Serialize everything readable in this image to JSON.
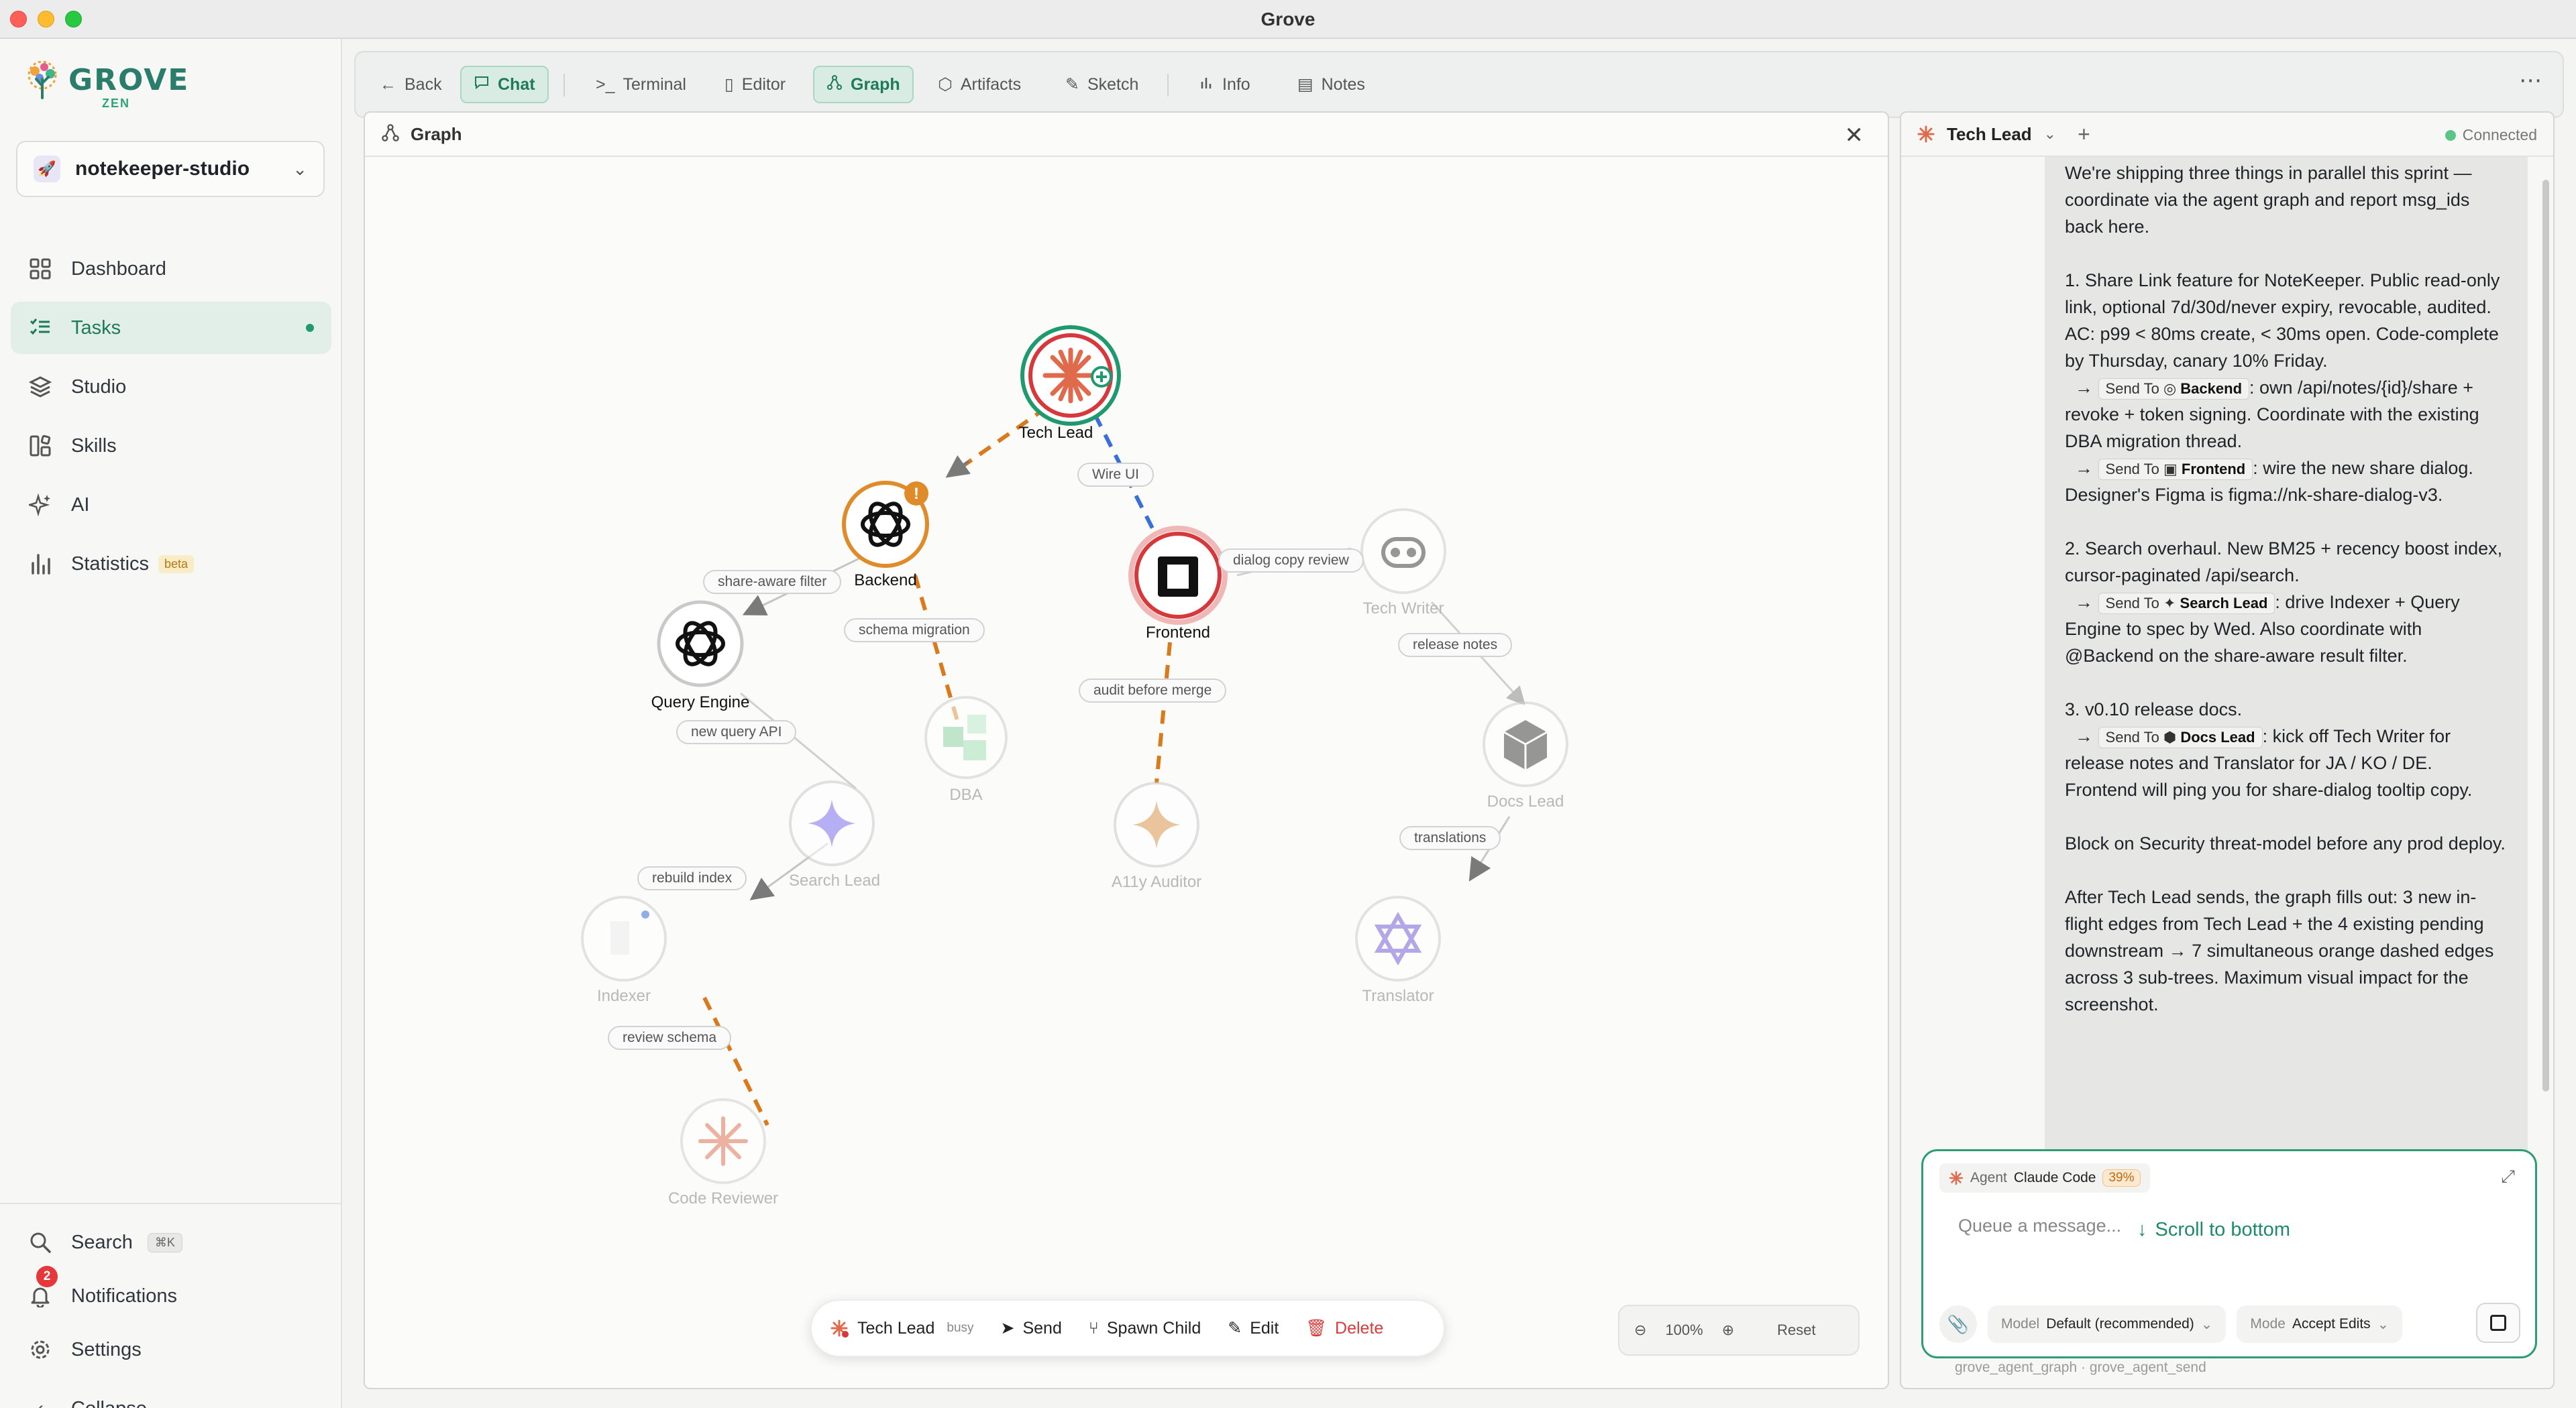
{
  "window": {
    "title": "Grove"
  },
  "sidebar": {
    "logo_text": "GROVE",
    "logo_sub": "ZEN",
    "project": "notekeeper-studio",
    "nav": [
      {
        "label": "Dashboard",
        "icon": "grid-icon"
      },
      {
        "label": "Tasks",
        "icon": "checklist-icon"
      },
      {
        "label": "Studio",
        "icon": "layers-icon"
      },
      {
        "label": "Skills",
        "icon": "blocks-icon"
      },
      {
        "label": "AI",
        "icon": "sparkles-icon"
      },
      {
        "label": "Statistics",
        "icon": "bar-chart-icon",
        "badge": "beta"
      }
    ],
    "active_item": "Tasks",
    "bottom": {
      "search": "Search",
      "search_shortcut": "⌘K",
      "notifications": "Notifications",
      "notifications_count": "2",
      "settings": "Settings",
      "collapse": "Collapse"
    }
  },
  "tabs": {
    "back": "Back",
    "items": [
      "Chat",
      "Terminal",
      "Editor",
      "Graph",
      "Artifacts",
      "Sketch",
      "Info",
      "Notes"
    ],
    "selected": [
      "Chat",
      "Graph"
    ]
  },
  "graph": {
    "panel_title": "Graph",
    "nodes": [
      {
        "name": "Tech Lead",
        "status": "busy"
      },
      {
        "name": "Backend",
        "status": "warning"
      },
      {
        "name": "Frontend",
        "status": "active"
      },
      {
        "name": "Query Engine",
        "status": "active"
      },
      {
        "name": "DBA",
        "status": "idle"
      },
      {
        "name": "Tech Writer",
        "status": "idle"
      },
      {
        "name": "Search Lead",
        "status": "idle"
      },
      {
        "name": "A11y Auditor",
        "status": "idle"
      },
      {
        "name": "Docs Lead",
        "status": "idle"
      },
      {
        "name": "Indexer",
        "status": "idle"
      },
      {
        "name": "Translator",
        "status": "idle"
      },
      {
        "name": "Code Reviewer",
        "status": "idle"
      }
    ],
    "edge_labels": {
      "wire_ui": "Wire UI",
      "share_aware_filter": "share-aware filter",
      "dialog_copy_review": "dialog copy review",
      "schema_migration": "schema migration",
      "release_notes": "release notes",
      "audit_before_merge": "audit before merge",
      "new_query_api": "new query API",
      "translations": "translations",
      "rebuild_index": "rebuild index",
      "review_schema": "review schema"
    },
    "toolbar": {
      "agent": "Tech Lead",
      "status": "busy",
      "send": "Send",
      "spawn": "Spawn Child",
      "edit": "Edit",
      "delete": "Delete"
    },
    "zoom": {
      "level": "100%",
      "reset": "Reset"
    },
    "colors": {
      "pending_edge": "#d97a1c",
      "active_edge": "#3b6fd8",
      "idle_edge": "#cfcfcf"
    }
  },
  "chat": {
    "agent": "Tech Lead",
    "connection": "Connected",
    "message": {
      "p1": "We're shipping three things in parallel this sprint — coordinate via the agent graph and report msg_ids back here.",
      "p2": "1. Share Link feature for NoteKeeper. Public read-only link, optional 7d/30d/never expiry, revocable, audited. AC: p99 < 80ms create, < 30ms open. Code-complete by Thursday, canary 10% Friday.",
      "send_to": "Send To",
      "s1_target": "Backend",
      "s1_text": ": own /api/notes/{id}/share + revoke + token signing. Coordinate with the existing DBA migration thread.",
      "s2_target": "Frontend",
      "s2_text": ": wire the new share dialog. Designer's Figma is figma://nk-share-dialog-v3.",
      "p3": "2. Search overhaul. New BM25 + recency boost index, cursor-paginated /api/search.",
      "s3_target": "Search Lead",
      "s3_text": ": drive Indexer + Query Engine to spec by Wed. Also coordinate with @Backend on the share-aware result filter.",
      "p4": "3. v0.10 release docs.",
      "s4_target": "Docs Lead",
      "s4_text": ": kick off Tech Writer for release notes and Translator for JA / KO / DE. Frontend will ping you for share-dialog tooltip copy.",
      "p5": "Block on Security threat-model before any prod deploy.",
      "p6": "After Tech Lead sends, the graph fills out: 3 new in-flight edges from Tech Lead + the 4 existing pending downstream → 7 simultaneous orange dashed edges across 3 sub-trees. Maximum visual impact for the screenshot."
    },
    "scroll_bottom": "Scroll to bottom",
    "composer": {
      "agent_label": "Agent",
      "agent_value": "Claude Code",
      "context_pct": "39%",
      "placeholder": "Queue a message...",
      "model_label": "Model",
      "model_value": "Default (recommended)",
      "mode_label": "Mode",
      "mode_value": "Accept Edits"
    },
    "tools_line": "grove_agent_graph · grove_agent_send"
  }
}
